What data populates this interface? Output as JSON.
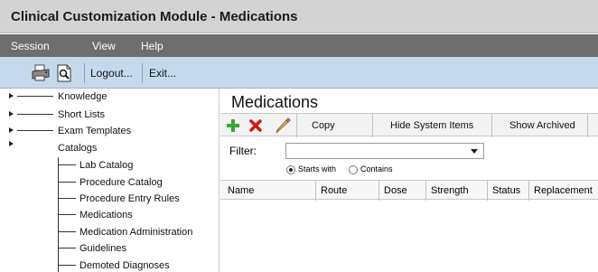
{
  "window": {
    "title": "Clinical Customization Module - Medications"
  },
  "menubar": {
    "items": [
      "Session",
      "View",
      "Help"
    ]
  },
  "toolbar": {
    "print_icon": "printer-icon",
    "preview_icon": "print-preview-icon",
    "logout_label": "Logout...",
    "exit_label": "Exit..."
  },
  "tree": {
    "roots": [
      {
        "label": "Knowledge",
        "expanded": false
      },
      {
        "label": "Short Lists",
        "expanded": false
      },
      {
        "label": "Exam Templates",
        "expanded": false
      },
      {
        "label": "Catalogs",
        "expanded": true
      }
    ],
    "catalog_children": [
      "Lab Catalog",
      "Procedure Catalog",
      "Procedure Entry Rules",
      "Medications",
      "Medication Administration",
      "Guidelines",
      "Demoted Diagnoses"
    ]
  },
  "main": {
    "title": "Medications",
    "actions": {
      "add_icon": "plus-icon",
      "delete_icon": "delete-x-icon",
      "edit_icon": "pencil-icon",
      "copy_label": "Copy",
      "hide_system_label": "Hide System Items",
      "show_archived_label": "Show Archived"
    },
    "filter": {
      "label": "Filter:",
      "value": "",
      "mode_options": [
        "Starts with",
        "Contains"
      ],
      "selected_mode": "Starts with"
    },
    "table": {
      "columns": [
        "Name",
        "Route",
        "Dose",
        "Strength",
        "Status",
        "Replacement"
      ],
      "rows": []
    }
  },
  "colors": {
    "titlebar_bg": "#d3d3d3",
    "menubar_bg": "#6e6e6e",
    "toolbar_bg": "#c5d9ec",
    "add_green": "#3aa53a",
    "delete_red": "#d01818"
  }
}
